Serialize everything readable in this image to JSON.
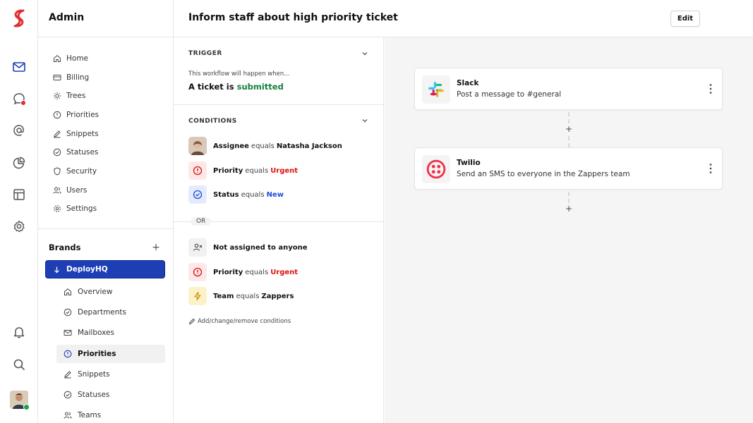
{
  "colors": {
    "accent": "#1d3eb5",
    "success": "#15803d",
    "danger": "#dd1111",
    "info": "#1d4ed8"
  },
  "sidebar": {
    "title": "Admin",
    "items": [
      {
        "label": "Home",
        "icon": "home-icon"
      },
      {
        "label": "Billing",
        "icon": "credit-card-icon"
      },
      {
        "label": "Trees",
        "icon": "sun-icon"
      },
      {
        "label": "Priorities",
        "icon": "alert-circle-icon"
      },
      {
        "label": "Snippets",
        "icon": "pencil-icon"
      },
      {
        "label": "Statuses",
        "icon": "check-circle-icon"
      },
      {
        "label": "Security",
        "icon": "shield-icon"
      },
      {
        "label": "Users",
        "icon": "users-icon"
      },
      {
        "label": "Settings",
        "icon": "gear-icon"
      }
    ],
    "brands_title": "Brands",
    "brand_selected": "DeployHQ",
    "brand_items": [
      {
        "label": "Overview",
        "icon": "home-icon"
      },
      {
        "label": "Departments",
        "icon": "check-circle-icon"
      },
      {
        "label": "Mailboxes",
        "icon": "mail-icon"
      },
      {
        "label": "Priorities",
        "icon": "alert-circle-icon"
      },
      {
        "label": "Snippets",
        "icon": "pencil-icon"
      },
      {
        "label": "Statuses",
        "icon": "check-circle-icon"
      },
      {
        "label": "Teams",
        "icon": "users-icon"
      }
    ]
  },
  "header": {
    "title": "Inform staff about high priority ticket",
    "edit_label": "Edit"
  },
  "trigger": {
    "section_title": "TRIGGER",
    "subtitle": "This workflow will happen when...",
    "prefix": "A ticket is",
    "event": "submitted"
  },
  "conditions": {
    "section_title": "CONDITIONS",
    "group1": [
      {
        "field": "Assignee",
        "op": "equals",
        "value": "Natasha Jackson"
      },
      {
        "field": "Priority",
        "op": "equals",
        "value": "Urgent"
      },
      {
        "field": "Status",
        "op": "equals",
        "value": "New"
      }
    ],
    "or_label": "OR",
    "group2": [
      {
        "field": "Not assigned to anyone"
      },
      {
        "field": "Priority",
        "op": "equals",
        "value": "Urgent"
      },
      {
        "field": "Team",
        "op": "equals",
        "value": "Zappers"
      }
    ],
    "add_label": "Add/change/remove conditions"
  },
  "actions": [
    {
      "name": "Slack",
      "description": "Post a message to #general",
      "icon": "slack-logo"
    },
    {
      "name": "Twilio",
      "description": "Send an SMS to everyone in the Zappers team",
      "icon": "twilio-logo"
    }
  ]
}
